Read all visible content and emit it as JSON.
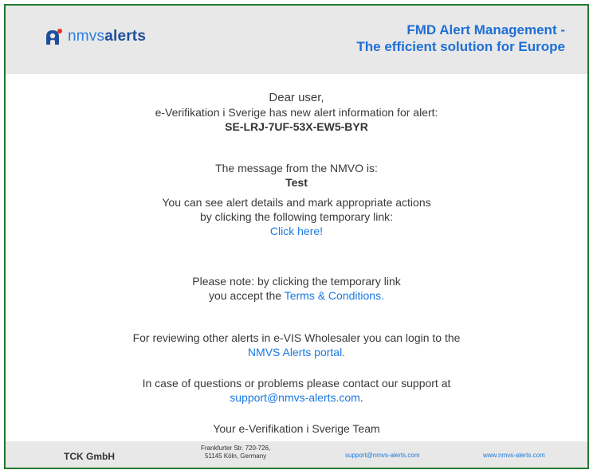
{
  "header": {
    "logo_light": "nmvs",
    "logo_bold": "alerts",
    "title_line1": "FMD Alert Management -",
    "title_line2": "The efficient solution for Europe"
  },
  "body": {
    "greeting": "Dear user,",
    "intro": "e-Verifikation i Sverige has new alert information for alert:",
    "alert_id": "SE-LRJ-7UF-53X-EW5-BYR",
    "message_label": "The message from the NMVO is:",
    "message_value": "Test",
    "details_line1": "You can see alert details and mark appropriate actions",
    "details_line2": "by clicking the following temporary link:",
    "click_here": "Click here!",
    "note_line1": "Please note: by clicking the temporary link",
    "note_prefix": "you accept the ",
    "terms_link": "Terms & Conditions.",
    "review_line1": "For reviewing other alerts in e-VIS Wholesaler you can login to the",
    "portal_link": "NMVS Alerts portal.",
    "support_line1": "In case of questions or problems please contact our support at",
    "support_email": "support@nmvs-alerts.com",
    "support_suffix": ".",
    "signature": "Your e-Verifikation i Sverige Team"
  },
  "footer": {
    "company": "TCK GmbH",
    "address_line1": "Frankfurter Str. 720-726,",
    "address_line2": "51145 Köln, Germany",
    "email": "support@nmvs-alerts.com",
    "website": "www.nmvs-alerts.com"
  },
  "colors": {
    "border": "#1f7a2e",
    "header_bg": "#e8e8e8",
    "accent": "#1f6fd6",
    "link": "#1a7ae0"
  }
}
